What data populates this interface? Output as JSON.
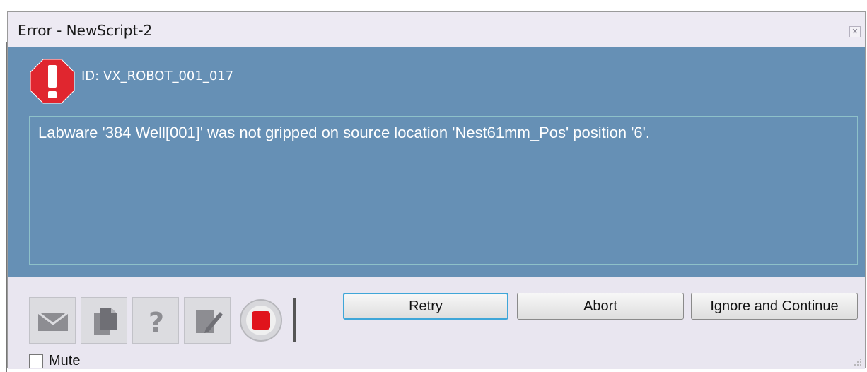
{
  "window": {
    "title": "Error - NewScript-2",
    "close_glyph": "✕"
  },
  "error": {
    "id_label": "ID: VX_ROBOT_001_017",
    "message": "Labware '384 Well[001]' was not gripped on source location 'Nest61mm_Pos' position '6'."
  },
  "toolbar": {
    "icons": [
      "mail-icon",
      "copy-icon",
      "help-icon",
      "edit-icon",
      "stop-icon"
    ]
  },
  "buttons": {
    "retry": "Retry",
    "abort": "Abort",
    "ignore": "Ignore and Continue"
  },
  "mute": {
    "label": "Mute",
    "checked": false
  },
  "colors": {
    "panel": "#6690b5",
    "error_red": "#e0262f",
    "focus_border": "#3fa6d8"
  }
}
